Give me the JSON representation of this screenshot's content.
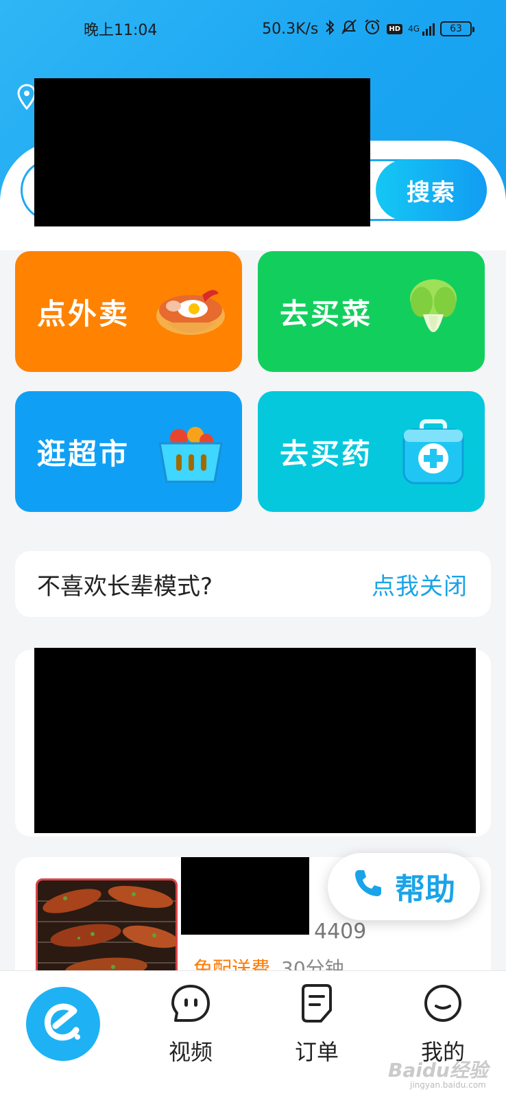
{
  "status_bar": {
    "time": "晚上11:04",
    "net_speed": "50.3K/s",
    "network": "4G",
    "battery": "63",
    "icons": [
      "bluetooth-icon",
      "mute-icon",
      "alarm-icon",
      "hd-icon",
      "signal-icon",
      "battery-icon"
    ]
  },
  "search": {
    "button_label": "搜索"
  },
  "tiles": [
    {
      "label": "点外卖",
      "icon": "noodle-bowl-icon",
      "color": "#ff8200"
    },
    {
      "label": "去买菜",
      "icon": "bok-choy-icon",
      "color": "#12cf5d"
    },
    {
      "label": "逛超市",
      "icon": "fruit-basket-icon",
      "color": "#0fa0f5"
    },
    {
      "label": "去买药",
      "icon": "medical-kit-icon",
      "color": "#05c8dd"
    }
  ],
  "elder_mode": {
    "text": "不喜欢长辈模式?",
    "link": "点我关闭"
  },
  "store": {
    "meta_suffix": "4409",
    "promo": "免配送费",
    "eta": "30分钟"
  },
  "help": {
    "label": "帮助"
  },
  "tabbar": {
    "items": [
      {
        "label": "视频",
        "icon": "video-face-icon"
      },
      {
        "label": "订单",
        "icon": "order-icon"
      },
      {
        "label": "我的",
        "icon": "profile-face-icon"
      }
    ]
  },
  "watermark": {
    "text": "Baidu经验",
    "sub": "jingyan.baidu.com"
  },
  "colors": {
    "accent": "#1aa3e8",
    "header": "#1aa5f2"
  }
}
